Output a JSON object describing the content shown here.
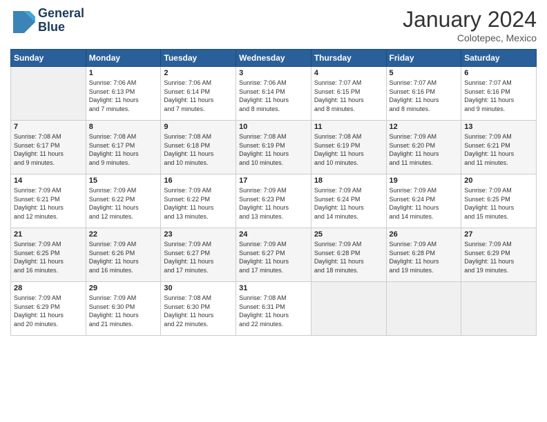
{
  "header": {
    "logo_line1": "General",
    "logo_line2": "Blue",
    "month": "January 2024",
    "location": "Colotepec, Mexico"
  },
  "weekdays": [
    "Sunday",
    "Monday",
    "Tuesday",
    "Wednesday",
    "Thursday",
    "Friday",
    "Saturday"
  ],
  "weeks": [
    [
      {
        "day": "",
        "info": ""
      },
      {
        "day": "1",
        "info": "Sunrise: 7:06 AM\nSunset: 6:13 PM\nDaylight: 11 hours\nand 7 minutes."
      },
      {
        "day": "2",
        "info": "Sunrise: 7:06 AM\nSunset: 6:14 PM\nDaylight: 11 hours\nand 7 minutes."
      },
      {
        "day": "3",
        "info": "Sunrise: 7:06 AM\nSunset: 6:14 PM\nDaylight: 11 hours\nand 8 minutes."
      },
      {
        "day": "4",
        "info": "Sunrise: 7:07 AM\nSunset: 6:15 PM\nDaylight: 11 hours\nand 8 minutes."
      },
      {
        "day": "5",
        "info": "Sunrise: 7:07 AM\nSunset: 6:16 PM\nDaylight: 11 hours\nand 8 minutes."
      },
      {
        "day": "6",
        "info": "Sunrise: 7:07 AM\nSunset: 6:16 PM\nDaylight: 11 hours\nand 9 minutes."
      }
    ],
    [
      {
        "day": "7",
        "info": "Sunrise: 7:08 AM\nSunset: 6:17 PM\nDaylight: 11 hours\nand 9 minutes."
      },
      {
        "day": "8",
        "info": "Sunrise: 7:08 AM\nSunset: 6:17 PM\nDaylight: 11 hours\nand 9 minutes."
      },
      {
        "day": "9",
        "info": "Sunrise: 7:08 AM\nSunset: 6:18 PM\nDaylight: 11 hours\nand 10 minutes."
      },
      {
        "day": "10",
        "info": "Sunrise: 7:08 AM\nSunset: 6:19 PM\nDaylight: 11 hours\nand 10 minutes."
      },
      {
        "day": "11",
        "info": "Sunrise: 7:08 AM\nSunset: 6:19 PM\nDaylight: 11 hours\nand 10 minutes."
      },
      {
        "day": "12",
        "info": "Sunrise: 7:09 AM\nSunset: 6:20 PM\nDaylight: 11 hours\nand 11 minutes."
      },
      {
        "day": "13",
        "info": "Sunrise: 7:09 AM\nSunset: 6:21 PM\nDaylight: 11 hours\nand 11 minutes."
      }
    ],
    [
      {
        "day": "14",
        "info": "Sunrise: 7:09 AM\nSunset: 6:21 PM\nDaylight: 11 hours\nand 12 minutes."
      },
      {
        "day": "15",
        "info": "Sunrise: 7:09 AM\nSunset: 6:22 PM\nDaylight: 11 hours\nand 12 minutes."
      },
      {
        "day": "16",
        "info": "Sunrise: 7:09 AM\nSunset: 6:22 PM\nDaylight: 11 hours\nand 13 minutes."
      },
      {
        "day": "17",
        "info": "Sunrise: 7:09 AM\nSunset: 6:23 PM\nDaylight: 11 hours\nand 13 minutes."
      },
      {
        "day": "18",
        "info": "Sunrise: 7:09 AM\nSunset: 6:24 PM\nDaylight: 11 hours\nand 14 minutes."
      },
      {
        "day": "19",
        "info": "Sunrise: 7:09 AM\nSunset: 6:24 PM\nDaylight: 11 hours\nand 14 minutes."
      },
      {
        "day": "20",
        "info": "Sunrise: 7:09 AM\nSunset: 6:25 PM\nDaylight: 11 hours\nand 15 minutes."
      }
    ],
    [
      {
        "day": "21",
        "info": "Sunrise: 7:09 AM\nSunset: 6:25 PM\nDaylight: 11 hours\nand 16 minutes."
      },
      {
        "day": "22",
        "info": "Sunrise: 7:09 AM\nSunset: 6:26 PM\nDaylight: 11 hours\nand 16 minutes."
      },
      {
        "day": "23",
        "info": "Sunrise: 7:09 AM\nSunset: 6:27 PM\nDaylight: 11 hours\nand 17 minutes."
      },
      {
        "day": "24",
        "info": "Sunrise: 7:09 AM\nSunset: 6:27 PM\nDaylight: 11 hours\nand 17 minutes."
      },
      {
        "day": "25",
        "info": "Sunrise: 7:09 AM\nSunset: 6:28 PM\nDaylight: 11 hours\nand 18 minutes."
      },
      {
        "day": "26",
        "info": "Sunrise: 7:09 AM\nSunset: 6:28 PM\nDaylight: 11 hours\nand 19 minutes."
      },
      {
        "day": "27",
        "info": "Sunrise: 7:09 AM\nSunset: 6:29 PM\nDaylight: 11 hours\nand 19 minutes."
      }
    ],
    [
      {
        "day": "28",
        "info": "Sunrise: 7:09 AM\nSunset: 6:29 PM\nDaylight: 11 hours\nand 20 minutes."
      },
      {
        "day": "29",
        "info": "Sunrise: 7:09 AM\nSunset: 6:30 PM\nDaylight: 11 hours\nand 21 minutes."
      },
      {
        "day": "30",
        "info": "Sunrise: 7:08 AM\nSunset: 6:30 PM\nDaylight: 11 hours\nand 22 minutes."
      },
      {
        "day": "31",
        "info": "Sunrise: 7:08 AM\nSunset: 6:31 PM\nDaylight: 11 hours\nand 22 minutes."
      },
      {
        "day": "",
        "info": ""
      },
      {
        "day": "",
        "info": ""
      },
      {
        "day": "",
        "info": ""
      }
    ]
  ]
}
